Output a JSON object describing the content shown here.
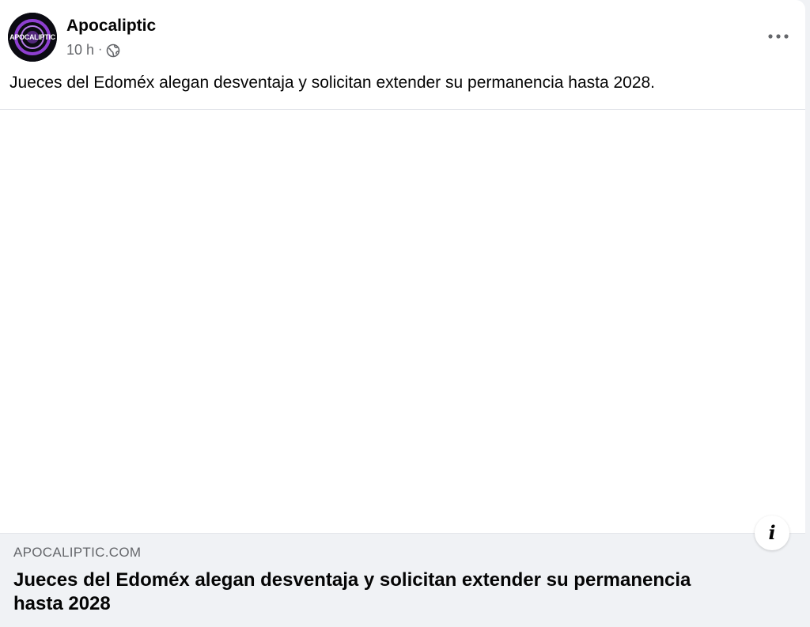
{
  "post": {
    "author": "Apocaliptic",
    "avatar_text": "APOCALIPTIC",
    "timestamp": "10 h",
    "separator": "·",
    "visibility_icon": "globe-icon",
    "more_icon": "more-horizontal-icon",
    "text": "Jueces del Edoméx alegan desventaja y solicitan extender su permanencia hasta 2028."
  },
  "link_preview": {
    "domain": "APOCALIPTIC.COM",
    "title": "Jueces del Edoméx alegan desventaja y solicitan extender su permanencia hasta 2028",
    "info_label": "i",
    "info_icon": "info-icon"
  },
  "colors": {
    "card_bg": "#ffffff",
    "page_bg": "#f0f2f5",
    "text_primary": "#050505",
    "text_secondary": "#65676b",
    "avatar_accent": "#8e3fd1"
  }
}
